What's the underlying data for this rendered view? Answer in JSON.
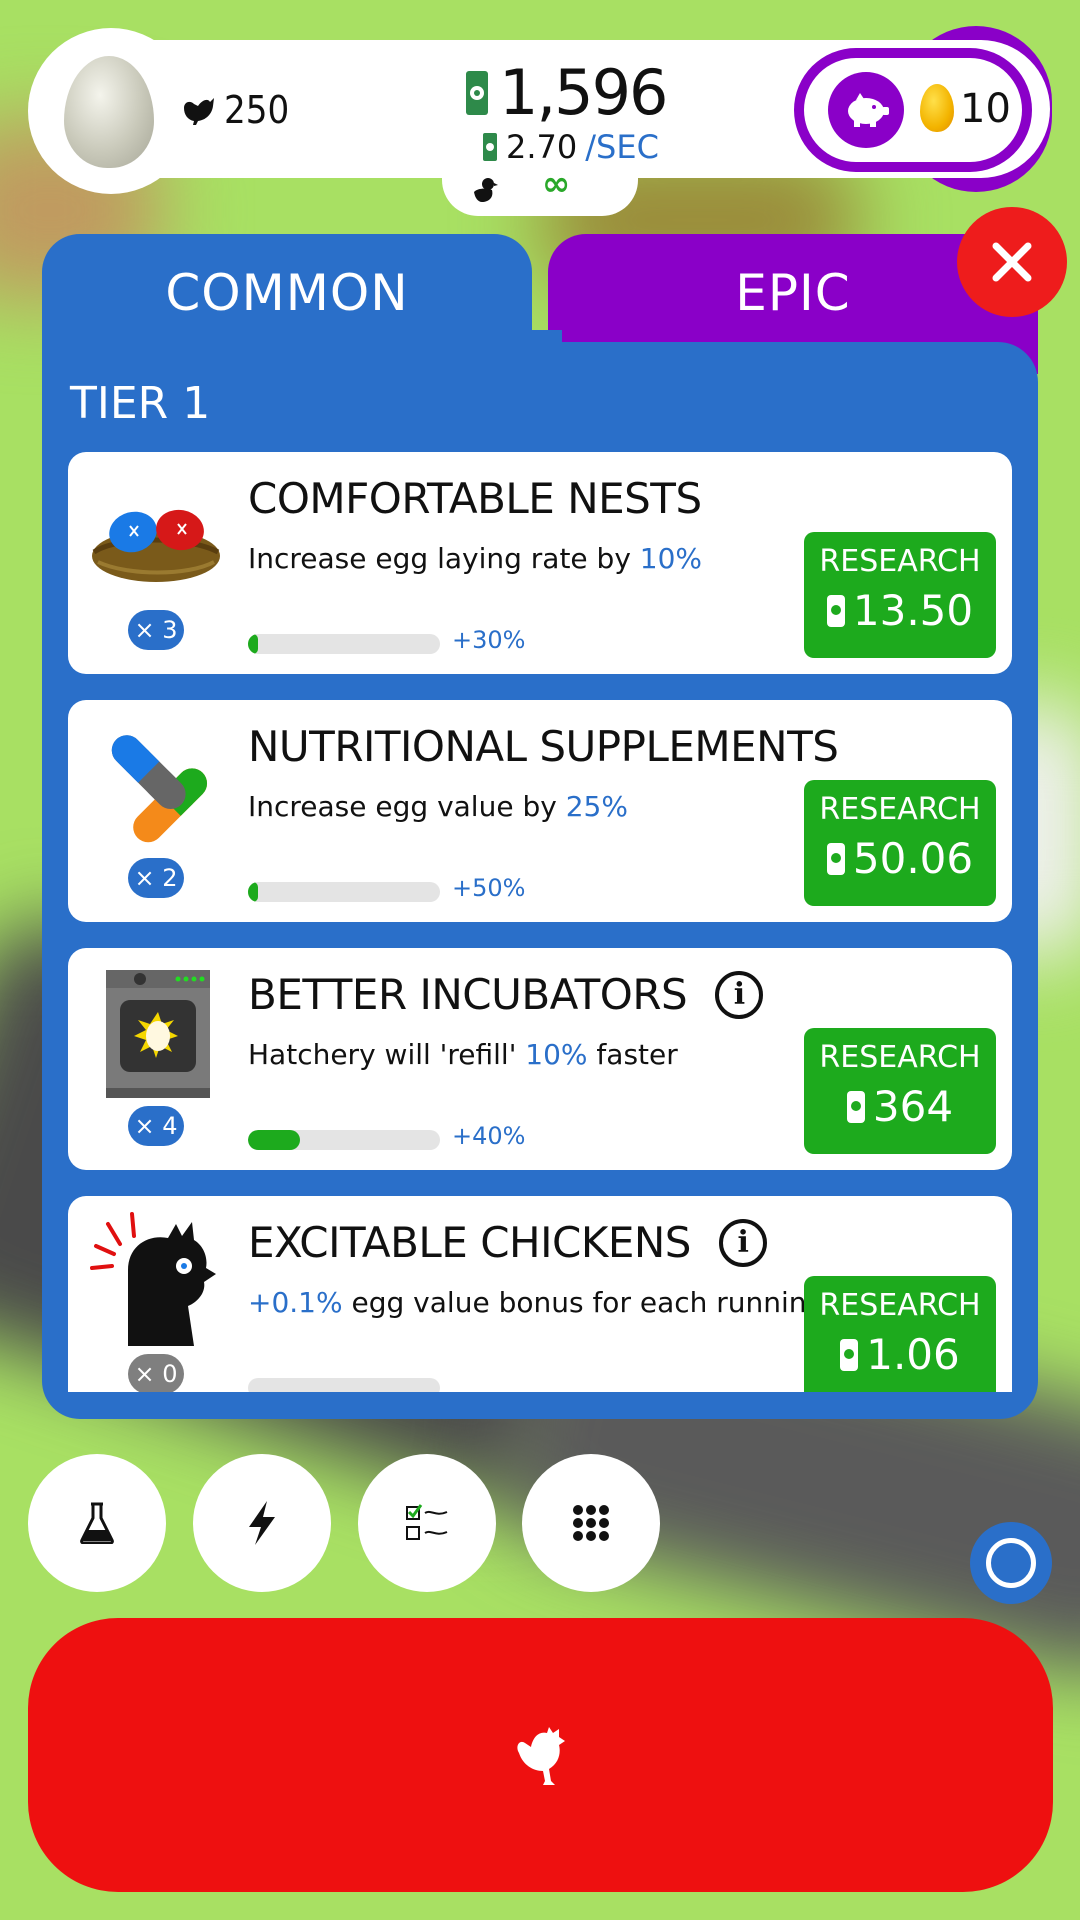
{
  "hud": {
    "chicken_count": "250",
    "money": "1,596",
    "rate_value": "2.70",
    "rate_unit": "/SEC",
    "habitat_capacity": "∞",
    "golden_eggs": "10"
  },
  "tabs": [
    {
      "label": "COMMON",
      "color": "#2a6fc9",
      "active": true
    },
    {
      "label": "EPIC",
      "color": "#8a00c8",
      "active": false
    }
  ],
  "tier_label": "TIER 1",
  "research_items": [
    {
      "title": "COMFORTABLE NESTS",
      "desc_pre": "Increase egg laying rate by ",
      "desc_hl": "10%",
      "desc_post": "",
      "level": "× 3",
      "progress": 0.03,
      "boost": "+30%",
      "button_label": "RESEARCH",
      "cost": "13.50",
      "icon": "nest-icon",
      "has_info": false
    },
    {
      "title": "NUTRITIONAL SUPPLEMENTS",
      "desc_pre": "Increase egg value by ",
      "desc_hl": "25%",
      "desc_post": "",
      "level": "× 2",
      "progress": 0.03,
      "boost": "+50%",
      "button_label": "RESEARCH",
      "cost": "50.06",
      "icon": "pills-icon",
      "has_info": false
    },
    {
      "title": "BETTER INCUBATORS",
      "desc_pre": "Hatchery will 'refill' ",
      "desc_hl": "10%",
      "desc_post": " faster",
      "level": "× 4",
      "progress": 0.27,
      "boost": "+40%",
      "button_label": "RESEARCH",
      "cost": "364",
      "icon": "incubator-icon",
      "has_info": true
    },
    {
      "title": "EXCITABLE CHICKENS",
      "desc_pre": "",
      "desc_hl": "+0.1%",
      "desc_post": " egg value bonus for each running chicken",
      "level": "× 0",
      "progress": 0,
      "boost": "",
      "button_label": "RESEARCH",
      "cost": "1.06",
      "icon": "excited-chicken-icon",
      "has_info": true
    }
  ],
  "bottom_buttons": [
    {
      "name": "research-button",
      "icon": "flask-icon"
    },
    {
      "name": "boosts-button",
      "icon": "lightning-icon"
    },
    {
      "name": "missions-button",
      "icon": "checklist-icon"
    },
    {
      "name": "menu-button",
      "icon": "grid-icon"
    }
  ],
  "colors": {
    "common_blue": "#2a6fc9",
    "epic_purple": "#8a00c8",
    "research_green": "#1daa1d",
    "hatch_red": "#ee1010",
    "background_green": "#a8e063"
  }
}
